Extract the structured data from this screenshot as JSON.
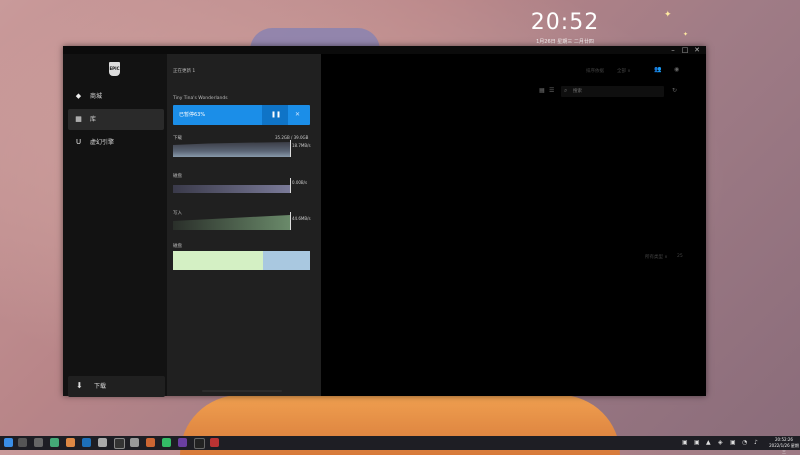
{
  "desktop": {
    "time": "20:52",
    "date": "1月26日  星期三  二月廿四"
  },
  "sidebar": {
    "logo_text": "EPIC",
    "items": [
      {
        "label": "商城",
        "icon": "tag-icon"
      },
      {
        "label": "库",
        "icon": "grid-icon"
      },
      {
        "label": "虚幻引擎",
        "icon": "unreal-icon"
      }
    ],
    "download_label": "下载"
  },
  "downloads": {
    "queue_label": "正在更新  1",
    "game_name": "Tiny Tina's Wonderlands",
    "progress_text": "已暂停63%",
    "progress_fraction": 0.63,
    "sections": [
      {
        "label": "下载",
        "stat_right": "35.2GB / 39.0GB",
        "stat_rate": "18.7MB/s"
      },
      {
        "label": "磁盘",
        "stat_rate": "0.00B/s"
      },
      {
        "label": "写入",
        "stat_rate": "44.6MB/s"
      },
      {
        "label": "磁盘"
      }
    ]
  },
  "library": {
    "top_links": [
      "排序依据",
      "全部 ∨"
    ],
    "search_placeholder": "搜索",
    "right_label": "所有类型 ∨",
    "right_value": "25"
  },
  "taskbar": {
    "clock_time": "20:52:26",
    "clock_date": "2022/1/26 星期三"
  }
}
